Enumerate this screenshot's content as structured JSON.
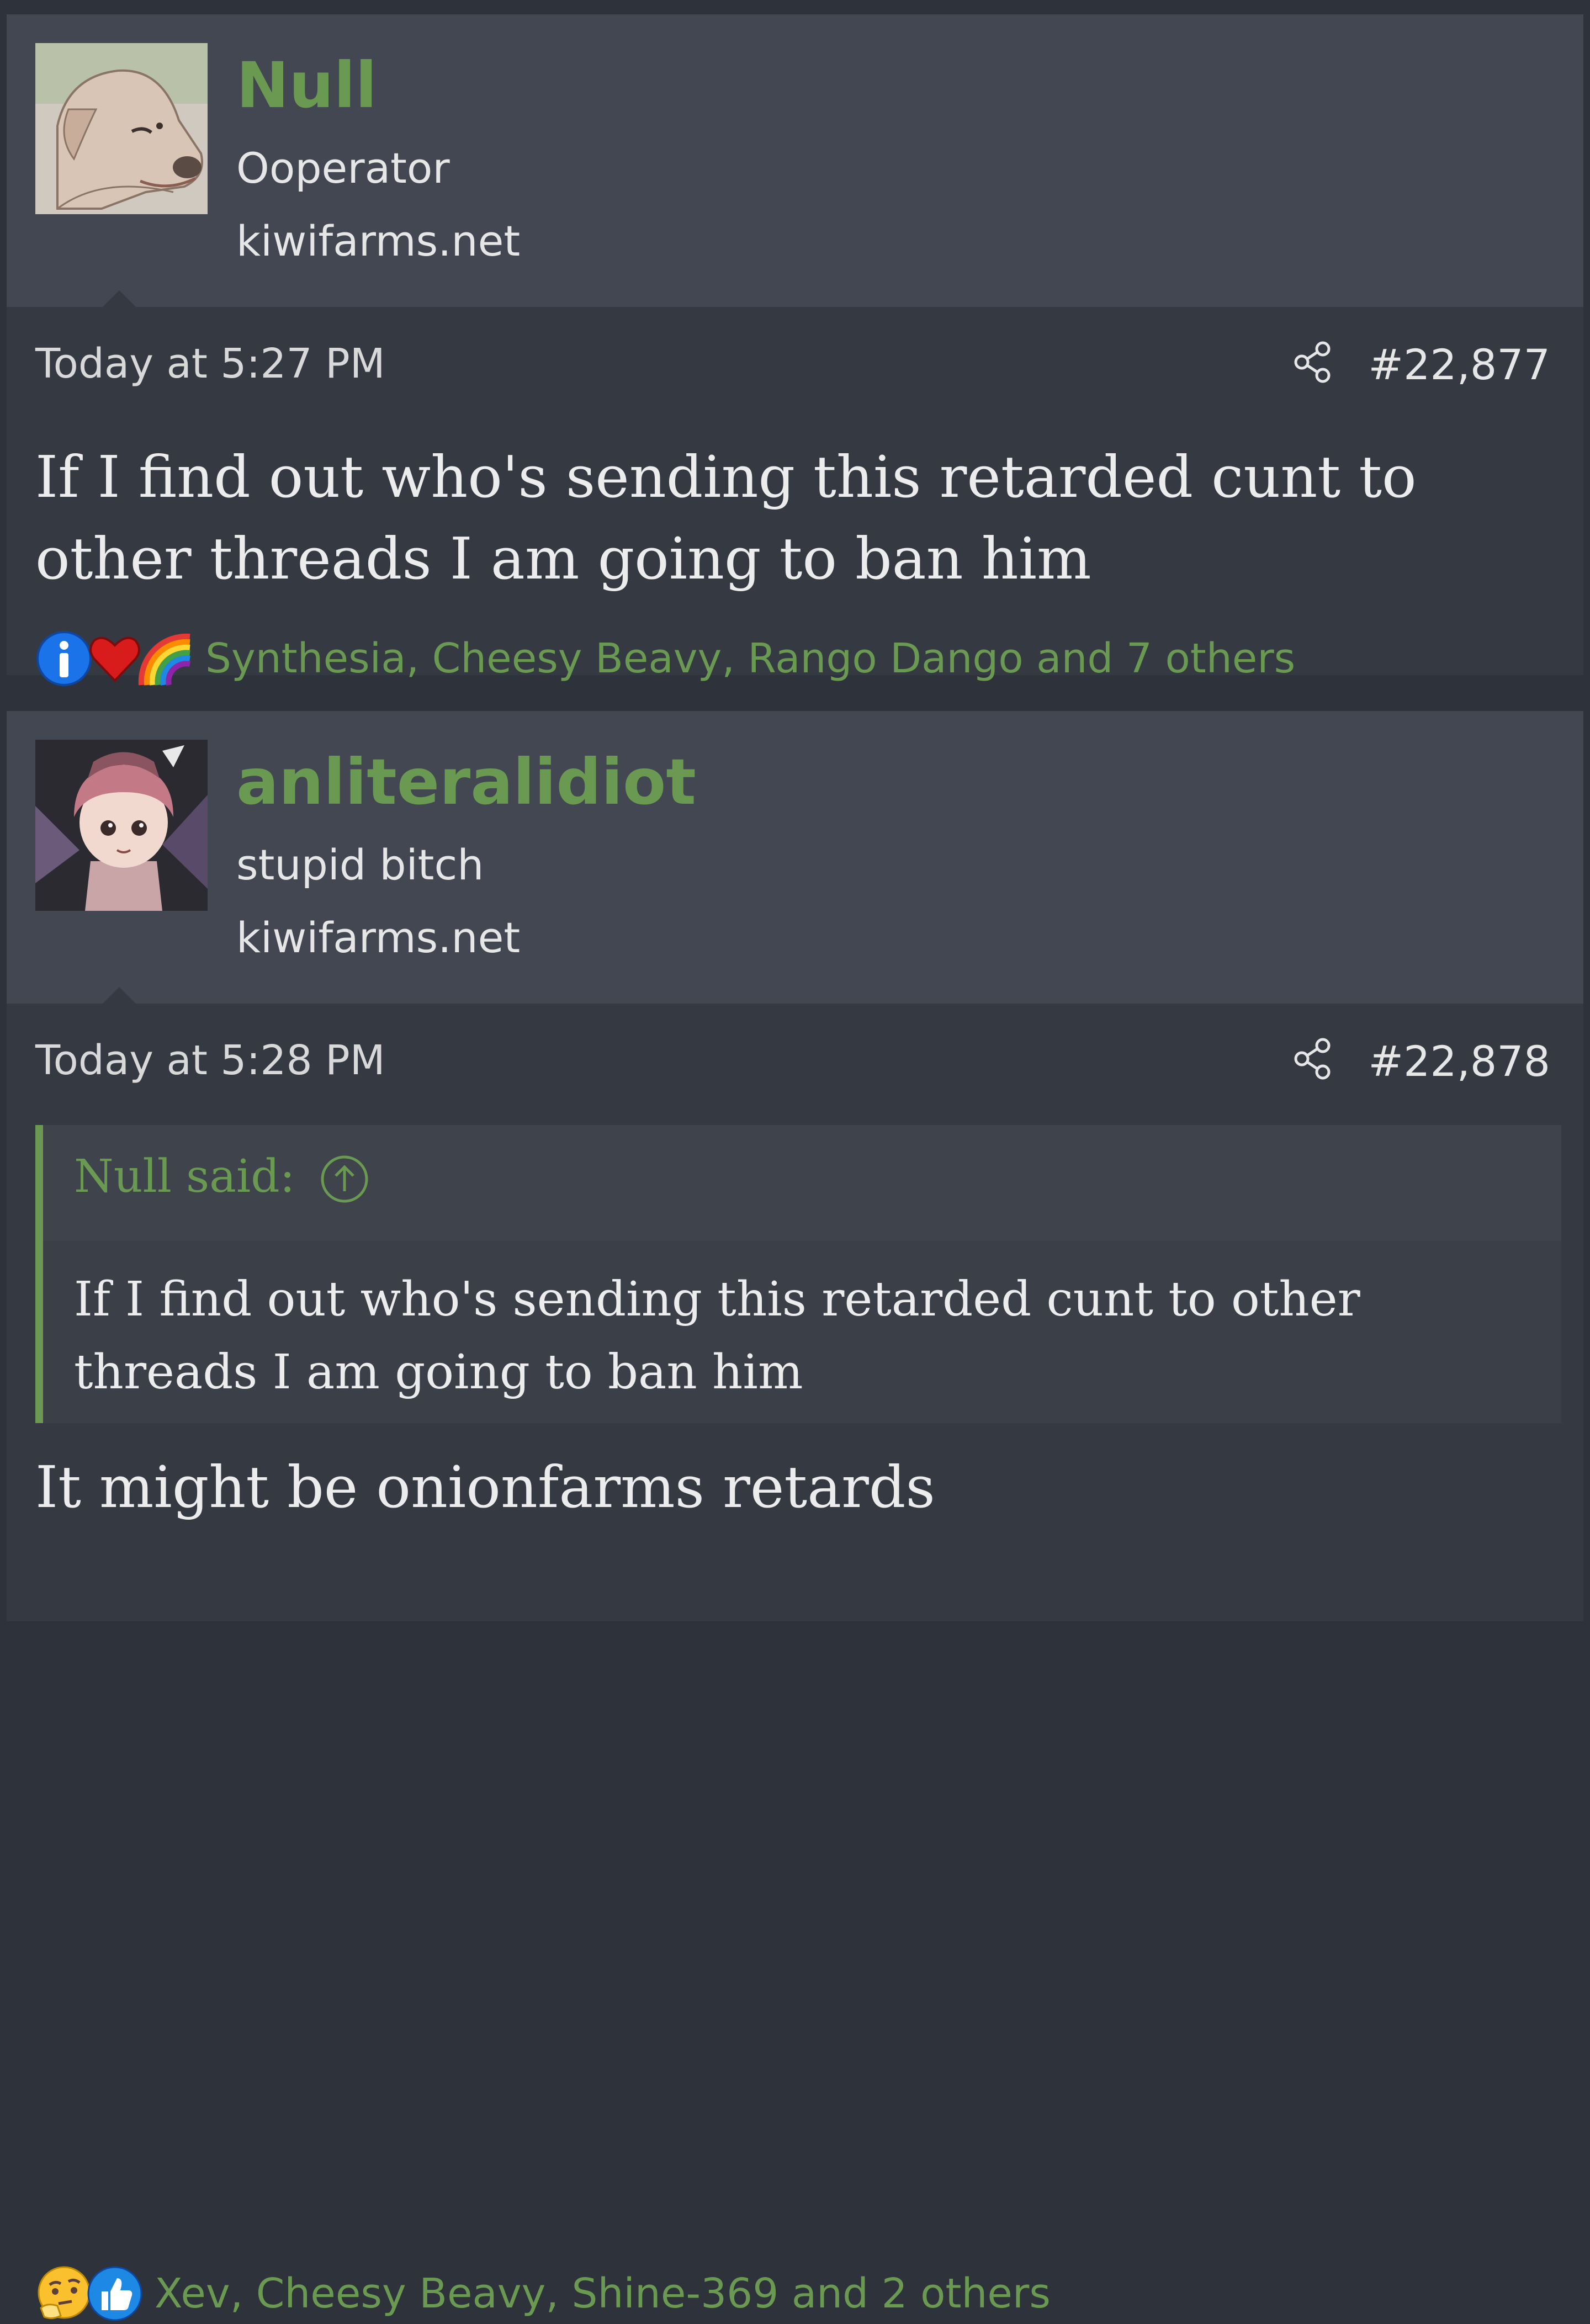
{
  "posts": [
    {
      "username": "Null",
      "user_title": "Ooperator",
      "user_site": "kiwifarms.net",
      "timestamp": "Today at 5:27 PM",
      "post_number": "#22,877",
      "message": "If I find out who's sending this retarded cunt to other threads I am going to ban him",
      "reactions_text": "Synthesia, Cheesy Beavy, Rango Dango and 7 others",
      "reaction_icons": [
        "informative-icon",
        "heart-icon",
        "rainbow-icon"
      ]
    },
    {
      "username": "anliteralidiot",
      "user_title": "stupid bitch",
      "user_site": "kiwifarms.net",
      "timestamp": "Today at 5:28 PM",
      "post_number": "#22,878",
      "quote": {
        "author": "Null said:",
        "text": "If I find out who's sending this retarded cunt to other threads I am going to ban him"
      },
      "message": "It might be onionfarms retards",
      "reactions_text": "Xev, Cheesy Beavy, Shine-369 and 2 others",
      "reaction_icons": [
        "thinking-face-icon",
        "thumbs-up-icon"
      ]
    }
  ],
  "colors": {
    "accent": "#6a9a51",
    "background": "#2e323a",
    "post_bg": "#353a42",
    "header_bg": "#424752",
    "text": "#ececec"
  }
}
